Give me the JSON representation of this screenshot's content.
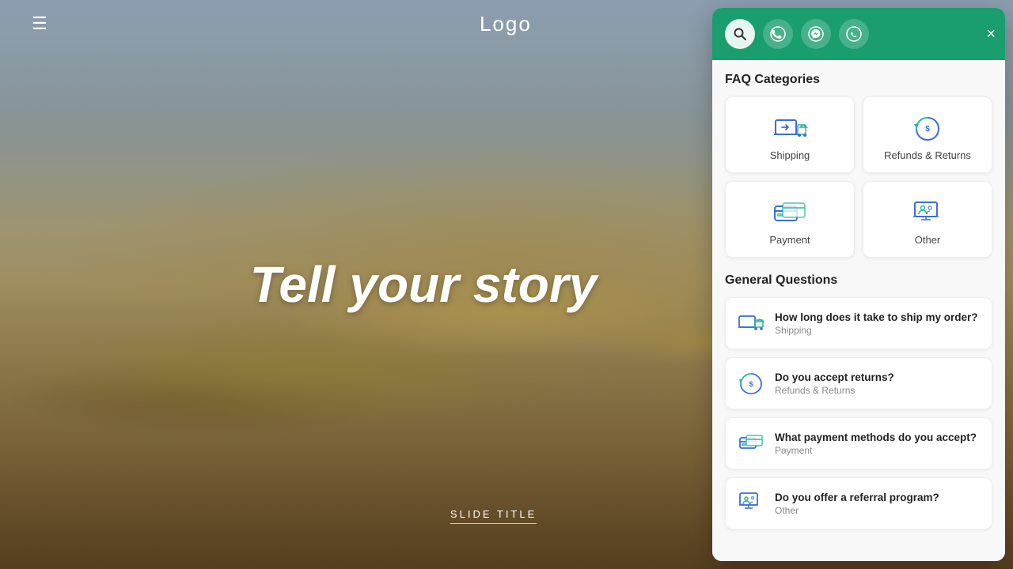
{
  "hero": {
    "title": "Tell your story",
    "slide_title": "SLIDE TITLE"
  },
  "navbar": {
    "logo": "Logo",
    "menu_icon": "≡"
  },
  "chat_panel": {
    "header": {
      "icons": [
        {
          "name": "search",
          "symbol": "🔍",
          "active": true
        },
        {
          "name": "whatsapp",
          "symbol": "📱",
          "active": false
        },
        {
          "name": "messenger",
          "symbol": "💬",
          "active": false
        },
        {
          "name": "phone",
          "symbol": "📞",
          "active": false
        }
      ],
      "close_label": "×"
    },
    "faq_section_title": "FAQ Categories",
    "categories": [
      {
        "id": "shipping",
        "label": "Shipping"
      },
      {
        "id": "refunds",
        "label": "Refunds & Returns"
      },
      {
        "id": "payment",
        "label": "Payment"
      },
      {
        "id": "other",
        "label": "Other"
      }
    ],
    "general_section_title": "General Questions",
    "questions": [
      {
        "id": "q1",
        "title": "How long does it take to ship my order?",
        "category": "Shipping"
      },
      {
        "id": "q2",
        "title": "Do you accept returns?",
        "category": "Refunds & Returns"
      },
      {
        "id": "q3",
        "title": "What payment methods do you accept?",
        "category": "Payment"
      },
      {
        "id": "q4",
        "title": "Do you offer a referral program?",
        "category": "Other"
      }
    ]
  },
  "colors": {
    "brand_green": "#1a9e6e",
    "icon_blue": "#3a6fd8",
    "icon_teal": "#2bb5a0"
  }
}
